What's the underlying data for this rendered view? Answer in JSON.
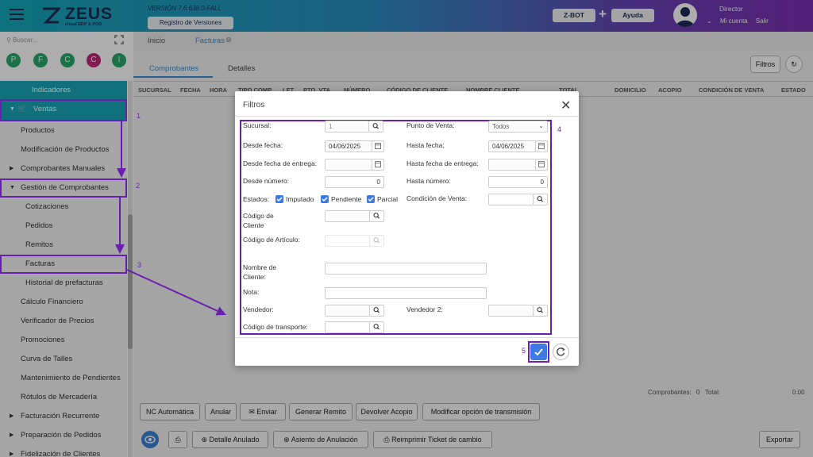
{
  "header": {
    "brand": "ZEUS",
    "brand_sub": "cloud ERP & POS",
    "version": "VERSIÓN 7.6.638.0-FALL",
    "reg_versions": "Registro de Versiones",
    "zbot": "Z-BOT",
    "plus": "+",
    "help": "Ayuda",
    "user_role": "Director",
    "my_account": "Mi cuenta",
    "logout": "Salir"
  },
  "sidebar": {
    "search_placeholder": "Buscar...",
    "quick": [
      "P",
      "F",
      "C",
      "C",
      "I"
    ],
    "items": [
      {
        "label": "Indicadores"
      },
      {
        "label": "Ventas"
      },
      {
        "label": "Productos"
      },
      {
        "label": "Modificación de Productos"
      },
      {
        "label": "Comprobantes Manuales"
      },
      {
        "label": "Gestión de Comprobantes"
      },
      {
        "label": "Cotizaciones"
      },
      {
        "label": "Pedidos"
      },
      {
        "label": "Remitos"
      },
      {
        "label": "Facturas"
      },
      {
        "label": "Historial de prefacturas"
      },
      {
        "label": "Cálculo Financiero"
      },
      {
        "label": "Verificador de Precios"
      },
      {
        "label": "Promociones"
      },
      {
        "label": "Curva de Talles"
      },
      {
        "label": "Mantenimiento de Pendientes"
      },
      {
        "label": "Rótulos de Mercadería"
      },
      {
        "label": "Facturación Recurrente"
      },
      {
        "label": "Preparación de Pedidos"
      },
      {
        "label": "Fidelización de Clientes"
      }
    ]
  },
  "annotations": [
    "1",
    "2",
    "3",
    "4",
    "5"
  ],
  "tabs": {
    "home": "Inicio",
    "invoices": "Facturas",
    "sub": [
      "Comprobantes",
      "Detalles"
    ],
    "filters_btn": "Filtros"
  },
  "grid": {
    "headers": [
      "SUCURSAL",
      "FECHA",
      "HORA",
      "TIPO COMP.",
      "LET.",
      "PTO. VTA.",
      "NÚMERO",
      "CÓDIGO DE CLIENTE",
      "NOMBRE CLIENTE",
      "TOTAL",
      "DOMICILIO",
      "ACOPIO",
      "CONDICIÓN DE VENTA",
      "ESTADO"
    ]
  },
  "footer": {
    "count_label": "Comprobantes:",
    "count_value": "0",
    "total_label": "Total:",
    "total_value": "0.00",
    "actions": [
      "NC Automática",
      "Anular",
      "Enviar",
      "Generar Remito",
      "Devolver Acopio",
      "Modificar opción de transmisión"
    ],
    "actions2": [
      "Detalle Anulado",
      "Asiento de Anulación",
      "Reimprimir Ticket de cambio"
    ],
    "export": "Exportar"
  },
  "modal": {
    "title": "Filtros",
    "sucursal_label": "Sucursal:",
    "sucursal_value": "1",
    "pv_label": "Punto de Venta:",
    "pv_value": "Todos",
    "desde_fecha_label": "Desde fecha:",
    "desde_fecha_value": "04/06/2025",
    "hasta_fecha_label": "Hasta fecha:",
    "hasta_fecha_value": "04/06/2025",
    "desde_entrega_label": "Desde fecha de entrega:",
    "hasta_entrega_label": "Hasta fecha de entrega:",
    "desde_num_label": "Desde número:",
    "desde_num_value": "0",
    "hasta_num_label": "Hasta número:",
    "hasta_num_value": "0",
    "estados_label": "Estados:",
    "estados": [
      "Imputado",
      "Pendiente",
      "Parcial"
    ],
    "cond_venta_label": "Condición de Venta:",
    "cod_cliente_label_1": "Código de",
    "cod_cliente_label_2": "Cliente",
    "cod_articulo_label": "Código de Artículo:",
    "nombre_cliente_label_1": "Nombre de",
    "nombre_cliente_label_2": "Cliente:",
    "nota_label": "Nota:",
    "vendedor_label": "Vendedor:",
    "vendedor2_label": "Vendedor 2:",
    "transporte_label": "Código de transporte:"
  },
  "colors": {
    "accent": "#6a1fb0",
    "primary": "#3d7be0",
    "teal": "#19a7b8"
  }
}
